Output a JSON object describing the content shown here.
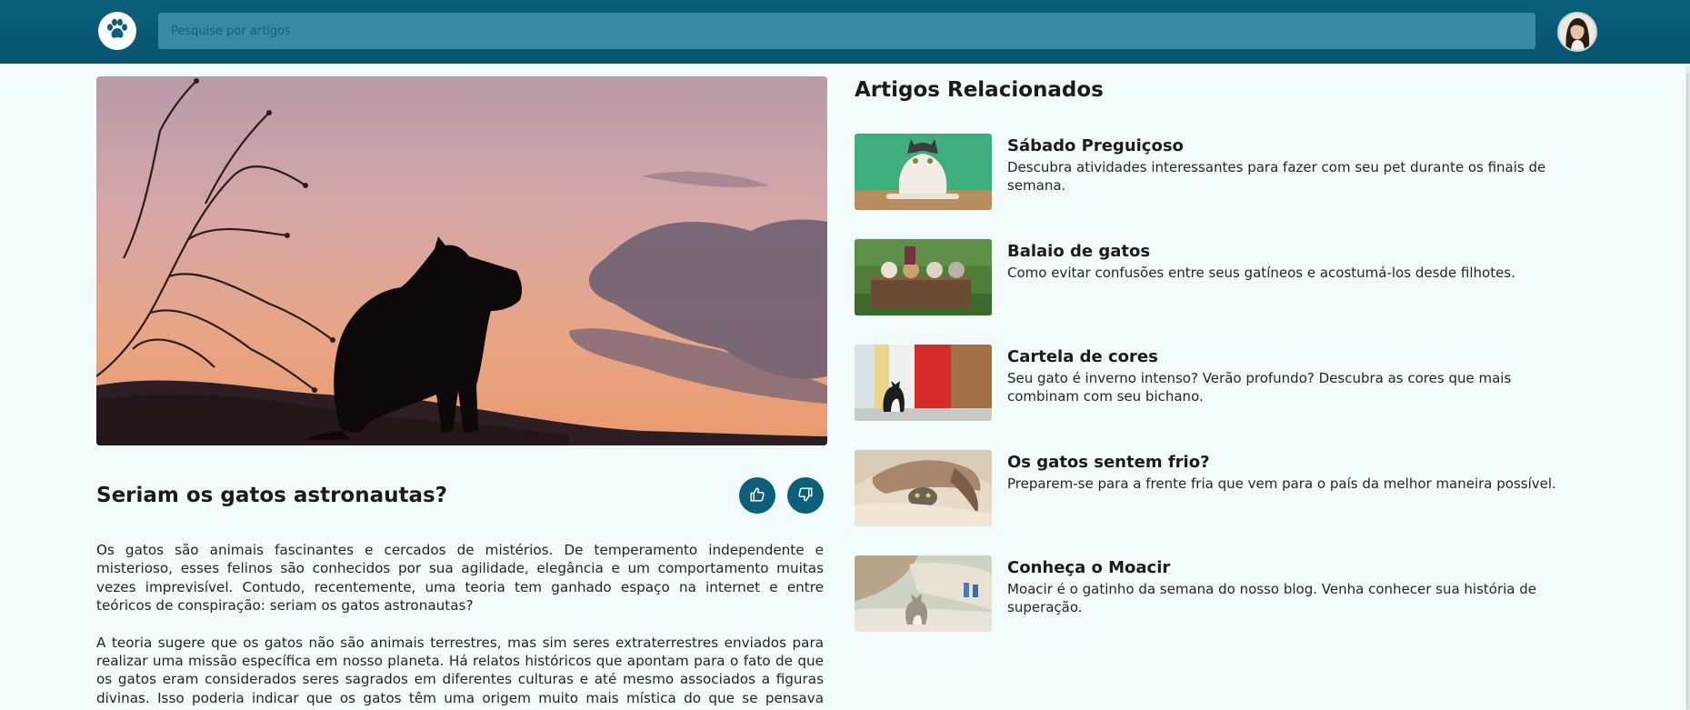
{
  "header": {
    "logo_icon": "paw-icon",
    "search_placeholder": "Pesquise por artigos",
    "avatar_icon": "user-avatar"
  },
  "article": {
    "title": "Seriam os gatos astronautas?",
    "like_icon": "thumbs-up-icon",
    "dislike_icon": "thumbs-down-icon",
    "paragraphs": [
      "Os gatos são animais fascinantes e cercados de mistérios. De temperamento independente e misterioso, esses felinos são conhecidos por sua agilidade, elegância e um comportamento muitas vezes imprevisível. Contudo, recentemente, uma teoria tem ganhado espaço na internet e entre teóricos de conspiração: seriam os gatos astronautas?",
      "A teoria sugere que os gatos não são animais terrestres, mas sim seres extraterrestres enviados para realizar uma missão específica em nosso planeta. Há relatos históricos que apontam para o fato de que os gatos eram considerados seres sagrados em diferentes culturas e até mesmo associados a figuras divinas. Isso poderia indicar que os gatos têm uma origem muito mais mística do que se pensava anteriormente."
    ]
  },
  "related": {
    "heading": "Artigos Relacionados",
    "items": [
      {
        "title": "Sábado Preguiçoso",
        "description": "Descubra atividades interessantes para fazer com seu pet durante os finais de semana."
      },
      {
        "title": "Balaio de gatos",
        "description": "Como evitar confusões entre seus gatíneos e acostumá-los desde filhotes."
      },
      {
        "title": "Cartela de cores",
        "description": "Seu gato é inverno intenso? Verão profundo? Descubra as cores que mais combinam com seu bichano."
      },
      {
        "title": "Os gatos sentem frio?",
        "description": "Preparem-se para a frente fria que vem para o país da melhor maneira possível."
      },
      {
        "title": "Conheça o Moacir",
        "description": "Moacir é o gatinho da semana do nosso blog. Venha conhecer sua história de superação."
      }
    ]
  },
  "colors": {
    "header": "#0b5f7b",
    "search_bg": "#3a8aa3",
    "page_bg": "#f3fcfd",
    "button": "#0b5f7b"
  }
}
